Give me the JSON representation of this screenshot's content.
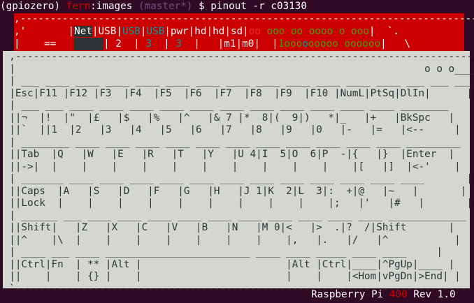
{
  "prompt": {
    "env": "(gpiozero)",
    "user": "fern",
    "host": "images",
    "branch": "(master*)",
    "symbol": "$",
    "command": "pinout -r c03130"
  },
  "header": {
    "l1": ",----------------------------------------------------------------------------.",
    "l2a": ",'",
    "l2b": "       |",
    "net": "Net",
    "usb1": "USB",
    "usb2": "USB",
    "usb3": "USB",
    "pwr": "pwr",
    "hd1": "hd",
    "hd2": "hd",
    "sd": "sd",
    "pins_top_a": "oo",
    "pins_top_b": "ooo oo oooo o ooo",
    "l2end": "|  `.",
    "l3a": "|    ==   ",
    "usb1_b": "2",
    "usb2_b": "3",
    "usb3_b": "3",
    "m1": "m1",
    "m0": "m0",
    "pins_bot_a": "1",
    "pins_bot_b": "ooo",
    "pins_bot_c": "o",
    "pins_bot_d": "ooooo oooooo",
    "l3end": "|   \\"
  },
  "body_lines": [
    "  ,-----------------------------------------------------------------------------.",
    "  |                                                                    o o o____ |",
    "  | ___ ____ ____ ____ ____ ____ ____ ____ ____ ____ ____ ____ ____ ___ ___ ___ |",
    "  |Esc|F11 |F12 |F3  |F4  |F5  |F6  |F7  |F8  |F9  |F10 |NumL|PtSq|DlIn|      |",
    "  | ___ ___ ____ ____ ____ ____ ____ ____ ____ ____ ____ ____ ____ ________     |",
    "  ||¬  |!  |\"  |£   |$   |%   |^   |& 7 |*  8|(  9|)   *|_   |+   |BkSpc   |    |",
    "  ||`  ||1  |2   |3   |4   |5   |6   |7   |8   |9   |0   |-   |=   |<--     |    |",
    "  | ________ ____ ____ ____ ____ ____ ____ ____ ____ ____ ____ ____ _________   |",
    "  ||Tab  |Q   |W   |E   |R   |T   |Y   |U 4|I  5|O  6|P  -|{   |}  |Enter  |   |",
    "  ||->|  |    |    |    |    |    |    |    |    |    |    |[   |]  |<-'    |   |",
    "  | _______ ____ ____ ____ ____ ____ ____ ____ ____ ____ ____ ____ ____       |  |",
    "  ||Caps  |A   |S   |D   |F   |G   |H   |J 1|K  2|L  3|:  +|@   |~   |       |  |",
    "  ||Lock  |    |    |    |    |    |    |    |    |    |;   |'   |#   |       |  |",
    "  | ______ ___ ____ ____ ____ ____ ____ ____ ____ ____ ____ ____ _____________   |",
    "  ||Shift|   |Z   |X   |C   |V   |B   |N   |M 0|<   |>  .|?  /|Shift       |   |",
    "  ||^    |\\  |    |    |    |    |    |    |    |,   |.   |/   |^           |   |",
    "  | ____ ___ ____ ________________________ ____ ____ _____ ____ ____     |",
    "  ||Ctrl|Fn  | ** |Alt |                        |Alt |Ctrl|____|^PgUp|____ |",
    "  ||    |    | {} |    |                        |    |    |<Hom|vPgDn|>End| |",
    "  `-----------------------------------------------------------------------------'"
  ],
  "footer": {
    "model_a": "Raspberry Pi",
    "model_num": "400",
    "model_b": "Rev 1.0"
  },
  "colors": {
    "terminal_bg": "#300a24",
    "board_red": "#cc0000",
    "board_body": "#d3d7cf",
    "pin_green": "#4e9a06",
    "pin_cyan": "#06989a"
  }
}
